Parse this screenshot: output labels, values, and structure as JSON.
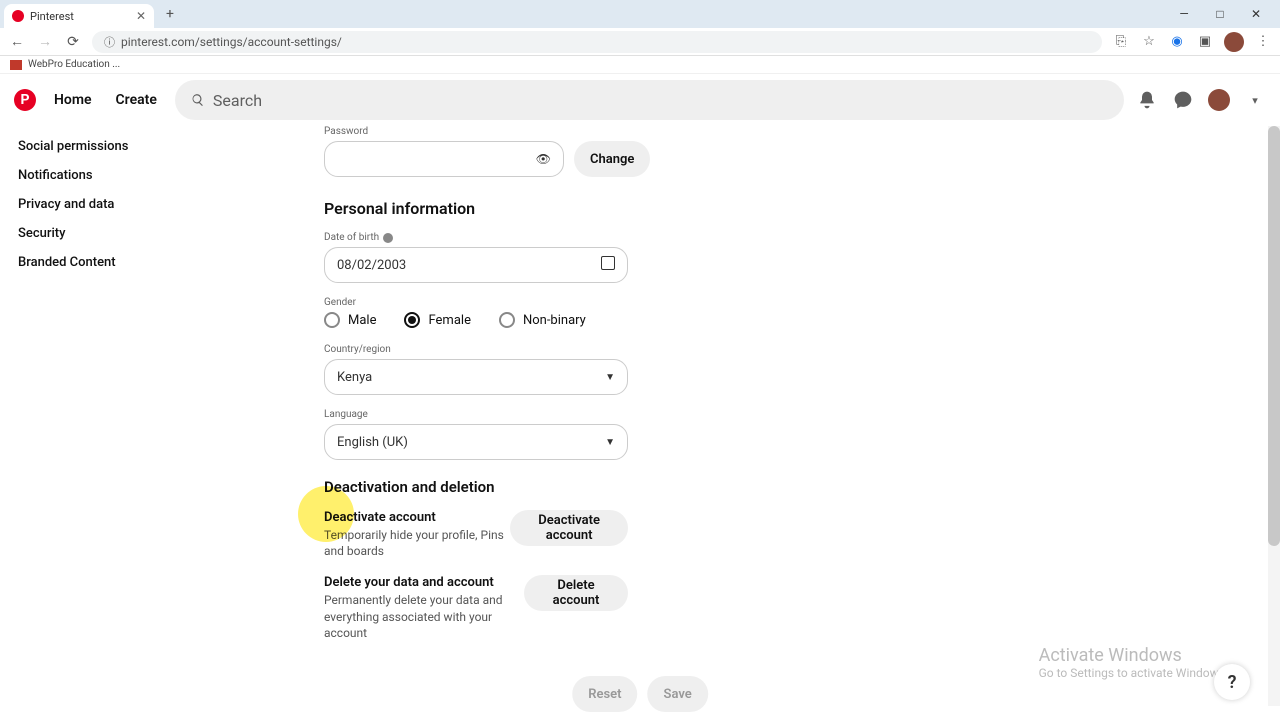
{
  "browser": {
    "tab_title": "Pinterest",
    "url": "pinterest.com/settings/account-settings/",
    "bookmark": "WebPro Education ..."
  },
  "window_controls": {
    "min": "—",
    "max": "□",
    "close": "✕"
  },
  "header": {
    "home": "Home",
    "create": "Create",
    "search_placeholder": "Search"
  },
  "sidebar": {
    "items": [
      "Social permissions",
      "Notifications",
      "Privacy and data",
      "Security",
      "Branded Content"
    ]
  },
  "password": {
    "label": "Password",
    "change": "Change"
  },
  "personal": {
    "title": "Personal information",
    "dob_label": "Date of birth",
    "dob_value": "08/02/2003",
    "gender_label": "Gender",
    "gender": {
      "male": "Male",
      "female": "Female",
      "nonbinary": "Non-binary",
      "selected": "female"
    },
    "country_label": "Country/region",
    "country_value": "Kenya",
    "language_label": "Language",
    "language_value": "English (UK)"
  },
  "deactivation": {
    "title": "Deactivation and deletion",
    "deactivate_title": "Deactivate account",
    "deactivate_desc": "Temporarily hide your profile, Pins and boards",
    "deactivate_btn": "Deactivate account",
    "delete_title": "Delete your data and account",
    "delete_desc": "Permanently delete your data and everything associated with your account",
    "delete_btn": "Delete account"
  },
  "footer": {
    "reset": "Reset",
    "save": "Save"
  },
  "watermark": {
    "line1": "Activate Windows",
    "line2": "Go to Settings to activate Windows."
  },
  "help": "?"
}
